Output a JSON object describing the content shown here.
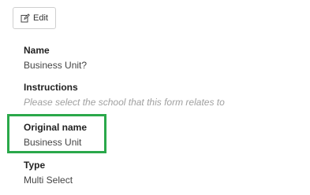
{
  "toolbar": {
    "edit_label": "Edit",
    "edit_icon": "edit-icon"
  },
  "fields": {
    "name": {
      "label": "Name",
      "value": "Business Unit?"
    },
    "instructions": {
      "label": "Instructions",
      "value": "Please select the school that this form relates to"
    },
    "original_name": {
      "label": "Original name",
      "value": "Business Unit"
    },
    "type": {
      "label": "Type",
      "value": "Multi Select"
    }
  },
  "colors": {
    "highlight": "#2aa84a"
  }
}
